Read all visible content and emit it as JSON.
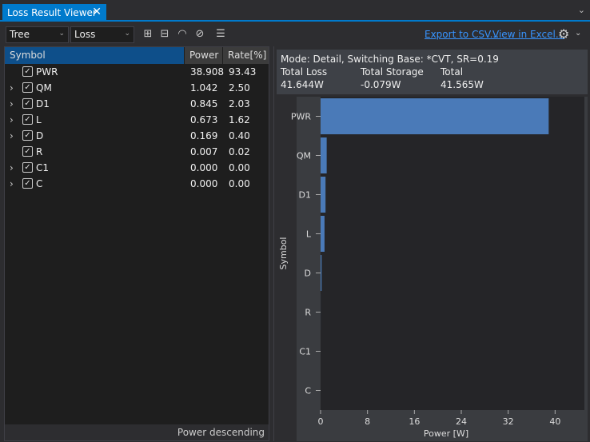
{
  "tab": {
    "title": "Loss Result Viewer",
    "close": "✕"
  },
  "toolbar": {
    "view": "Tree",
    "type": "Loss",
    "export": "Export to CSV...",
    "excel": "View in Excel..."
  },
  "table": {
    "headers": [
      "Symbol",
      "Power",
      "Rate[%]"
    ],
    "rows": [
      {
        "symbol": "PWR",
        "power": "38.908",
        "rate": "93.43",
        "expandable": false
      },
      {
        "symbol": "QM",
        "power": "1.042",
        "rate": "2.50",
        "expandable": true
      },
      {
        "symbol": "D1",
        "power": "0.845",
        "rate": "2.03",
        "expandable": true
      },
      {
        "symbol": "L",
        "power": "0.673",
        "rate": "1.62",
        "expandable": true
      },
      {
        "symbol": "D",
        "power": "0.169",
        "rate": "0.40",
        "expandable": true
      },
      {
        "symbol": "R",
        "power": "0.007",
        "rate": "0.02",
        "expandable": false
      },
      {
        "symbol": "C1",
        "power": "0.000",
        "rate": "0.00",
        "expandable": true
      },
      {
        "symbol": "C",
        "power": "0.000",
        "rate": "0.00",
        "expandable": true
      }
    ],
    "footer": "Power descending"
  },
  "info": {
    "mode": "Mode: Detail, Switching Base: *CVT, SR=0.19",
    "total_loss_label": "Total Loss",
    "total_loss": "41.644W",
    "total_storage_label": "Total Storage",
    "total_storage": "-0.079W",
    "total_label": "Total",
    "total": "41.565W"
  },
  "colors": {
    "accent": "#007acc",
    "bar": "#4a7ab8",
    "link": "#3794ff"
  },
  "chart_data": {
    "type": "bar",
    "orientation": "horizontal",
    "categories": [
      "PWR",
      "QM",
      "D1",
      "L",
      "D",
      "R",
      "C1",
      "C"
    ],
    "values": [
      38.908,
      1.042,
      0.845,
      0.673,
      0.169,
      0.007,
      0.0,
      0.0
    ],
    "xlabel": "Power [W]",
    "ylabel": "Symbol",
    "xlim": [
      0,
      45
    ],
    "xticks": [
      0,
      8,
      16,
      24,
      32,
      40
    ]
  }
}
